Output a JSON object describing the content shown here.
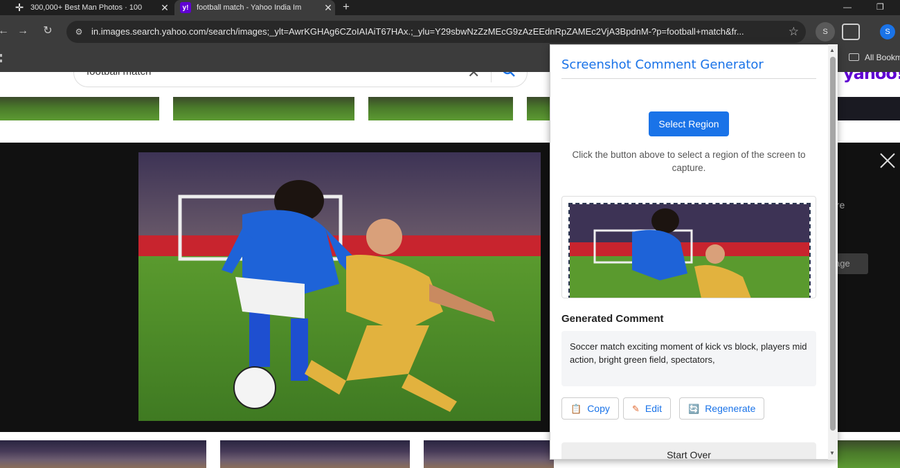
{
  "tabs": [
    {
      "icon": "p-icon",
      "title": "300,000+ Best Man Photos · 100",
      "close": "✕"
    },
    {
      "icon": "yahoo-icon",
      "title": "football match - Yahoo India Im",
      "close": "✕"
    }
  ],
  "new_tab": "+",
  "address": {
    "url": "in.images.search.yahoo.com/search/images;_ylt=AwrKGHAg6CZoIAIAiT67HAx.;_ylu=Y29sbwNzZzMEcG9zAzEEdnRpZAMEc2VjA3BpdnM-?p=football+match&fr..."
  },
  "profile_initial": "S",
  "avatar_initial": "S",
  "bookmarks": {
    "all": "All Bookm"
  },
  "search": {
    "query": "football match"
  },
  "yahoo_logo": "yahoo!",
  "viewer_side": {
    "line1": "e",
    "line2": "ore",
    "line3": "0",
    "button": "age"
  },
  "popup": {
    "title": "Screenshot Comment Generator",
    "select_button": "Select Region",
    "hint": "Click the button above to select a region of the screen to capture.",
    "generated_label": "Generated Comment",
    "comment": "Soccer match exciting moment of kick vs block, players mid action, bright green field, spectators,",
    "copy": "Copy",
    "edit": "Edit",
    "regenerate": "Regenerate",
    "start_over": "Start Over",
    "colors": {
      "accent": "#1a73e8"
    }
  }
}
